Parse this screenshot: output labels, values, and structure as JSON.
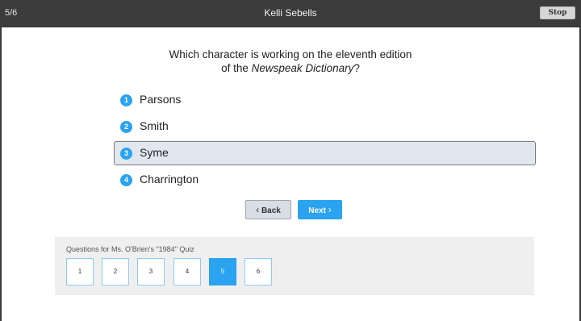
{
  "header": {
    "progress": "5/6",
    "user_name": "Kelli Sebells",
    "stop_label": "Stop"
  },
  "question": {
    "line1": "Which character is working on the eleventh edition",
    "line2_prefix": "of the ",
    "line2_title": "Newspeak Dictionary",
    "line2_suffix": "?"
  },
  "options": [
    {
      "number": "1",
      "label": "Parsons",
      "selected": false
    },
    {
      "number": "2",
      "label": "Smith",
      "selected": false
    },
    {
      "number": "3",
      "label": "Syme",
      "selected": true
    },
    {
      "number": "4",
      "label": "Charrington",
      "selected": false
    }
  ],
  "nav": {
    "back_label": "Back",
    "next_label": "Next"
  },
  "quiz": {
    "title": "Questions for Ms. O'Brien's \"1984\" Quiz",
    "questions": [
      "1",
      "2",
      "3",
      "4",
      "5",
      "6"
    ],
    "current": "5"
  },
  "colors": {
    "accent": "#2aa3f0",
    "topbar": "#3b3b3b",
    "selected_bg": "#e1e7ef",
    "panel_bg": "#efefef"
  }
}
